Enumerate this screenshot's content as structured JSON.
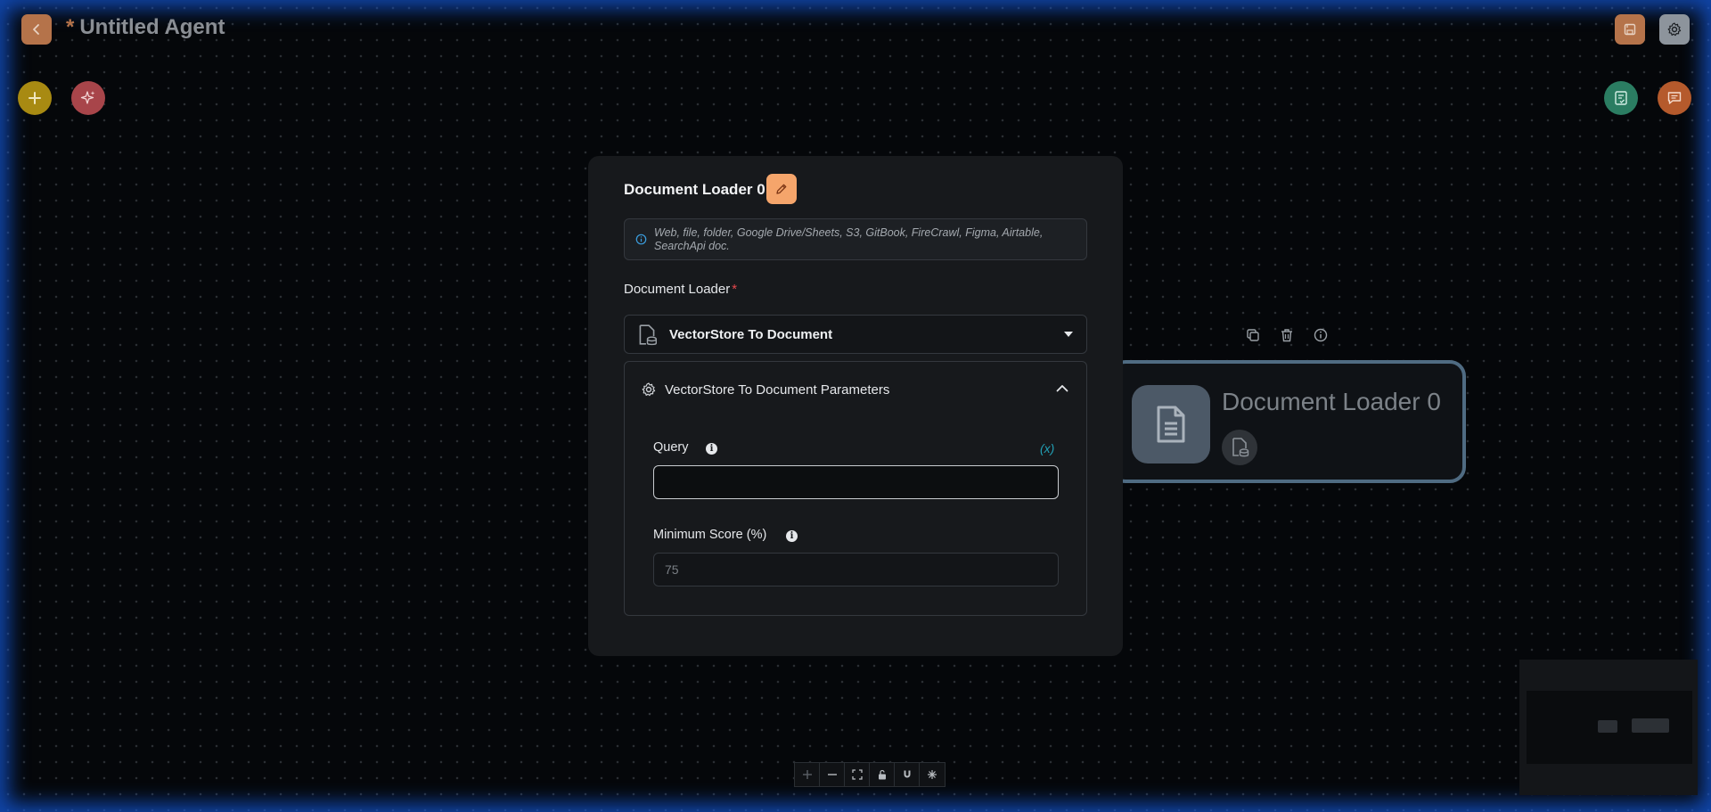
{
  "header": {
    "unsaved_marker": "*",
    "title": "Untitled Agent"
  },
  "icons": {
    "back": "chevron-left-icon",
    "save": "save-icon",
    "settings": "gear-icon",
    "add": "plus-icon",
    "magic": "sparkles-icon",
    "validate": "checklist-icon",
    "chat": "chat-icon",
    "duplicate": "copy-icon",
    "delete": "trash-icon",
    "info": "info-icon"
  },
  "colors": {
    "accent": "#f5a56b",
    "variable_toggle": "#22a0b5",
    "required": "#e5484d"
  },
  "modal": {
    "title": "Document Loader 0",
    "description": "Web, file, folder, Google Drive/Sheets, S3, GitBook, FireCrawl, Figma, Airtable, SearchApi doc.",
    "loader_label": "Document Loader",
    "required_marker": "*",
    "selected_loader": "VectorStore To Document",
    "params_title": "VectorStore To Document Parameters",
    "query_label": "Query",
    "query_value": "",
    "variable_toggle": "(x)",
    "min_score_label": "Minimum Score (%)",
    "min_score_placeholder": "75"
  },
  "node": {
    "title": "Document Loader 0"
  },
  "controls": [
    "zoom-in",
    "zoom-out",
    "fit-view",
    "lock",
    "snap-to-grid",
    "background-toggle"
  ]
}
